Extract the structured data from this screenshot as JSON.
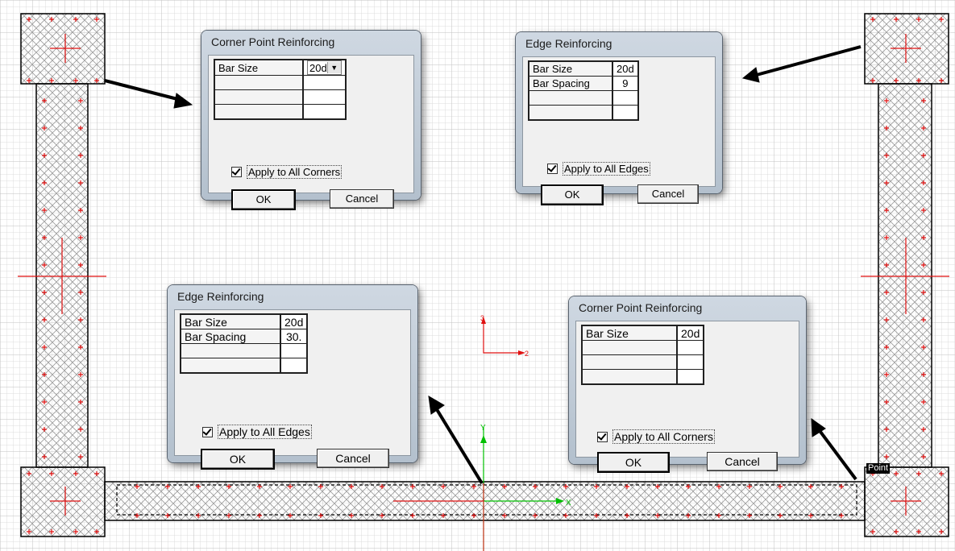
{
  "canvas": {
    "point_tag": "Point",
    "axis_upper": {
      "vertical": "3",
      "horizontal": "2"
    },
    "axis_lower": {
      "vertical": "Y",
      "horizontal": "X"
    }
  },
  "dialogs": {
    "corner_top": {
      "title": "Corner Point Reinforcing",
      "rows": [
        {
          "label": "Bar Size",
          "value": "20d"
        }
      ],
      "check_label": "Apply to All Corners",
      "ok": "OK",
      "cancel": "Cancel"
    },
    "edge_top": {
      "title": "Edge Reinforcing",
      "rows": [
        {
          "label": "Bar Size",
          "value": "20d"
        },
        {
          "label": "Bar Spacing",
          "value": "9"
        }
      ],
      "check_label": "Apply to All Edges",
      "ok": "OK",
      "cancel": "Cancel"
    },
    "edge_bottom": {
      "title": "Edge Reinforcing",
      "rows": [
        {
          "label": "Bar Size",
          "value": "20d"
        },
        {
          "label": "Bar Spacing",
          "value": "30."
        }
      ],
      "check_label": "Apply to All Edges",
      "ok": "OK",
      "cancel": "Cancel"
    },
    "corner_bottom": {
      "title": "Corner Point Reinforcing",
      "rows": [
        {
          "label": "Bar Size",
          "value": "20d"
        }
      ],
      "check_label": "Apply to All Corners",
      "ok": "OK",
      "cancel": "Cancel"
    }
  },
  "colors": {
    "rebar": "#e01010",
    "axis_green": "#00c000",
    "grid": "#d6d6d6",
    "outline": "#000000"
  }
}
